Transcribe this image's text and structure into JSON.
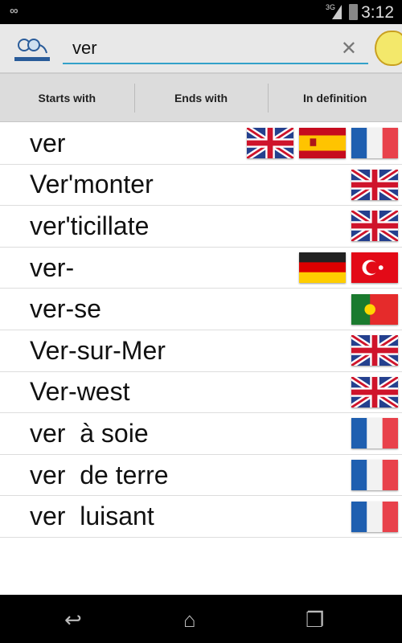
{
  "status_bar": {
    "network": "3G",
    "time": "3:12"
  },
  "toolbar": {
    "search_value": "ver"
  },
  "tabs": [
    {
      "label": "Starts with"
    },
    {
      "label": "Ends with"
    },
    {
      "label": "In definition"
    }
  ],
  "results": [
    {
      "word": "ver",
      "flags": [
        "uk",
        "es",
        "fr"
      ]
    },
    {
      "word": "Ver'monter",
      "flags": [
        "uk"
      ]
    },
    {
      "word": "ver'ticillate",
      "flags": [
        "uk"
      ]
    },
    {
      "word": "ver-",
      "flags": [
        "de",
        "tr"
      ]
    },
    {
      "word": "ver-se",
      "flags": [
        "pt"
      ]
    },
    {
      "word": "Ver-sur-Mer",
      "flags": [
        "uk"
      ]
    },
    {
      "word": "Ver-west",
      "flags": [
        "uk"
      ]
    },
    {
      "word": "ver  à soie",
      "flags": [
        "fr"
      ]
    },
    {
      "word": "ver  de terre",
      "flags": [
        "fr"
      ]
    },
    {
      "word": "ver  luisant",
      "flags": [
        "fr"
      ]
    }
  ],
  "colors": {
    "accent": "#33a1c9"
  }
}
